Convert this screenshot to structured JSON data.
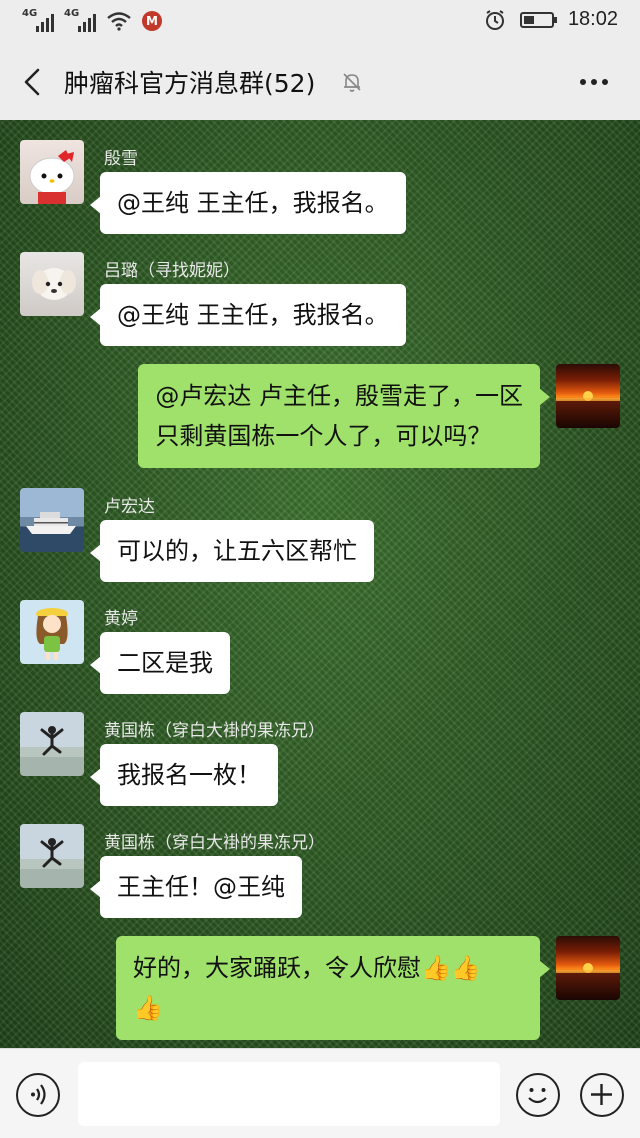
{
  "status_bar": {
    "signal1_label": "4G",
    "signal2_label": "4G",
    "carrier_icon_text": "M",
    "time": "18:02"
  },
  "header": {
    "title": "肿瘤科官方消息群(52)"
  },
  "messages": [
    {
      "side": "in",
      "sender": "殷雪",
      "text": "@王纯  王主任，我报名。",
      "avatar": "hello-kitty-avatar"
    },
    {
      "side": "in",
      "sender": "吕璐（寻找妮妮）",
      "text": "@王纯  王主任，我报名。",
      "avatar": "puppy-avatar"
    },
    {
      "side": "out",
      "lines": [
        "@卢宏达  卢主任，殷雪走了，一区",
        "只剩黄国栋一个人了，可以吗？"
      ],
      "avatar": "sunset-avatar"
    },
    {
      "side": "in",
      "sender": "卢宏达",
      "text": "可以的，让五六区帮忙",
      "avatar": "cruise-ship-avatar"
    },
    {
      "side": "in",
      "sender": "黄婷",
      "text": "二区是我",
      "avatar": "cartoon-girl-avatar"
    },
    {
      "side": "in",
      "sender": "黄国栋（穿白大褂的果冻兄）",
      "text": "我报名一枚！",
      "avatar": "jumping-man-avatar"
    },
    {
      "side": "in",
      "sender": "黄国栋（穿白大褂的果冻兄）",
      "text": "王主任！@王纯",
      "avatar": "jumping-man-avatar"
    },
    {
      "side": "out",
      "lines": [
        "好的，大家踊跃，令人欣慰👍👍",
        "👍"
      ],
      "avatar": "sunset-avatar"
    }
  ],
  "input": {
    "placeholder": ""
  },
  "colors": {
    "outgoing_bubble": "#9fe16a",
    "incoming_bubble": "#ffffff",
    "chat_background": "#2e5a25"
  }
}
